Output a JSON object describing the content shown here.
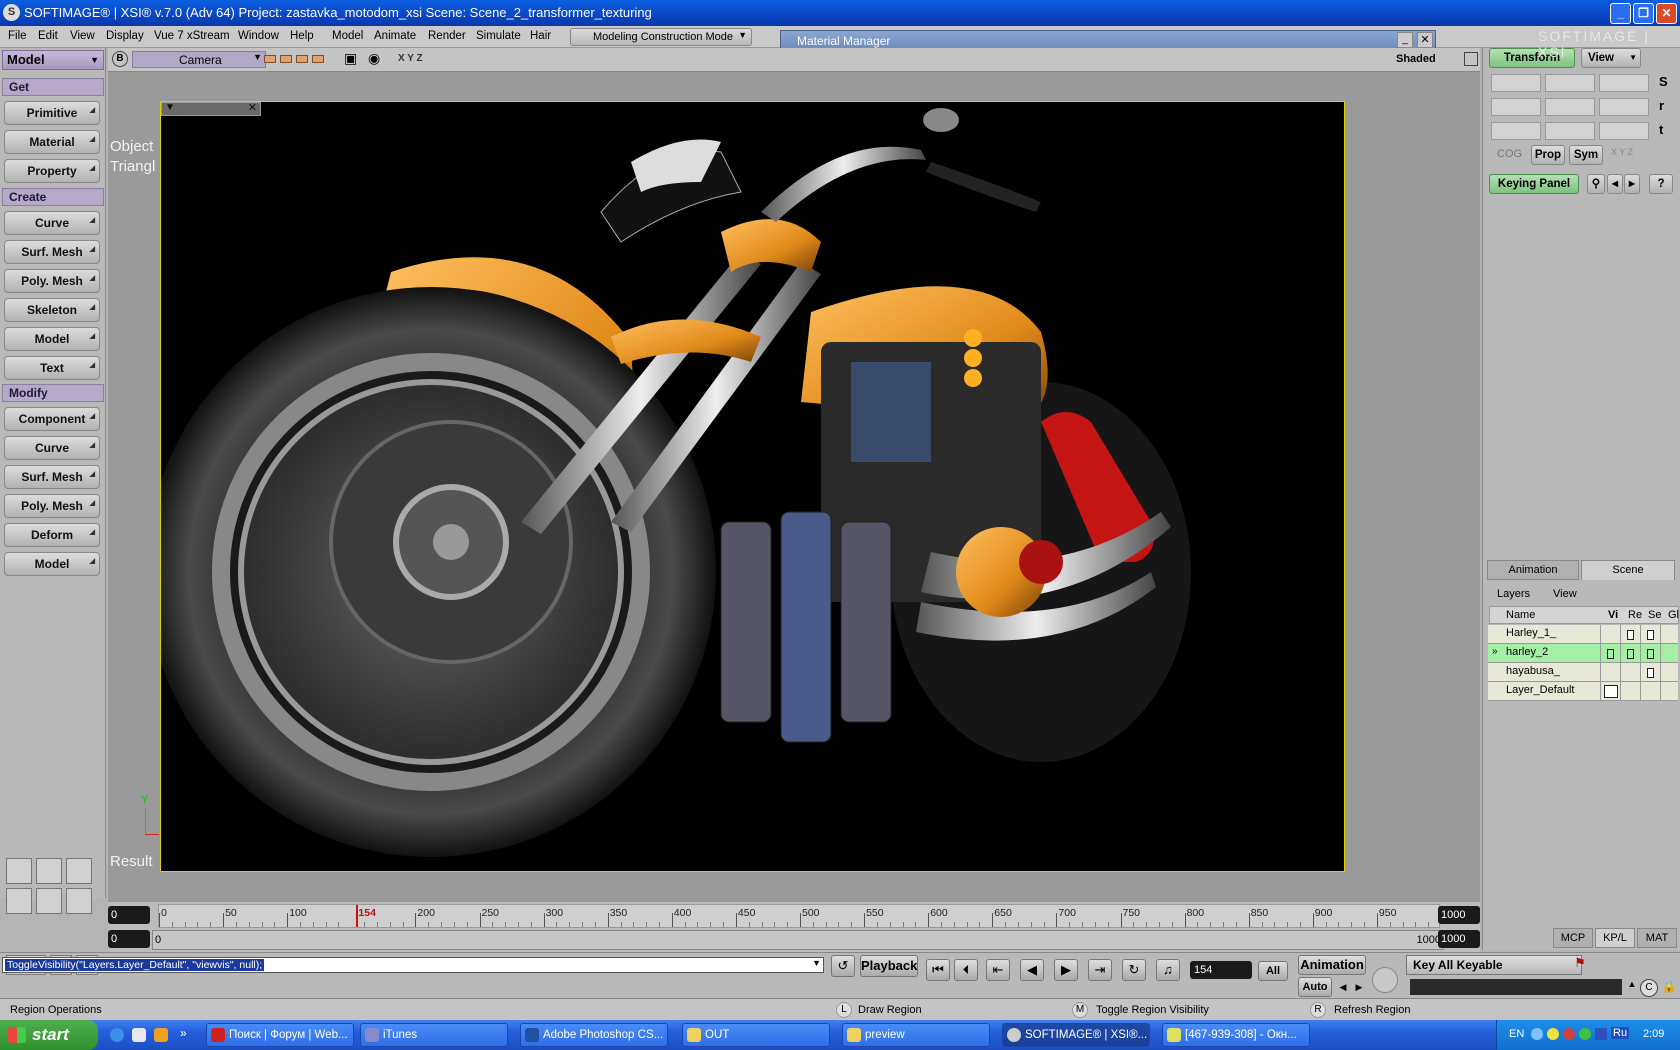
{
  "window": {
    "title": "SOFTIMAGE® | XSI® v.7.0 (Adv 64) Project: zastavka_motodom_xsi    Scene: Scene_2_transformer_texturing",
    "logo": "SOFTIMAGE | XSI"
  },
  "menubar": {
    "items": [
      "File",
      "Edit",
      "View",
      "Display",
      "Vue 7 xStream",
      "Window",
      "Help",
      "Model",
      "Animate",
      "Render",
      "Simulate",
      "Hair"
    ],
    "mode": "Modeling Construction Mode"
  },
  "material_manager": {
    "title": "Material Manager"
  },
  "left_panel": {
    "module": "Model",
    "sections": [
      {
        "title": "Get",
        "buttons": [
          "Primitive",
          "Material",
          "Property"
        ]
      },
      {
        "title": "Create",
        "buttons": [
          "Curve",
          "Surf. Mesh",
          "Poly. Mesh",
          "Skeleton",
          "Model",
          "Text"
        ]
      },
      {
        "title": "Modify",
        "buttons": [
          "Component",
          "Curve",
          "Surf. Mesh",
          "Poly. Mesh",
          "Deform",
          "Model"
        ]
      }
    ]
  },
  "viewport": {
    "letter": "B",
    "camera": "Camera",
    "axes": "X Y Z",
    "shading": "Shaded",
    "overlay_line1": "Object",
    "overlay_line2": "Triangl",
    "result_label": "Result",
    "y_axis": "Y"
  },
  "right_panel": {
    "transform": "Transform",
    "view": "View",
    "s": "S",
    "r": "r",
    "t": "t",
    "cog": "COG",
    "prop": "Prop",
    "sym": "Sym",
    "xyz": "X Y Z",
    "keying_panel": "Keying Panel",
    "help": "?",
    "tabs": [
      "Animation",
      "Scene"
    ],
    "layers_menu": "Layers",
    "view_menu": "View",
    "columns": [
      "Name",
      "Vi",
      "Re",
      "Se",
      "Gl"
    ],
    "layers": [
      {
        "name": "Harley_1_",
        "vi": false,
        "re": true,
        "se": true
      },
      {
        "name": "harley_2",
        "vi": true,
        "re": true,
        "se": true,
        "selected": true,
        "marker": "»"
      },
      {
        "name": "hayabusa_",
        "vi": false,
        "re": false,
        "se": true
      },
      {
        "name": "Layer_Default",
        "vi": true,
        "re": false,
        "se": false
      }
    ],
    "bottom_tabs": [
      "MCP",
      "KP/L",
      "MAT"
    ]
  },
  "timeline": {
    "start": "0",
    "labels": [
      "0",
      "50",
      "100",
      "154",
      "200",
      "250",
      "300",
      "350",
      "400",
      "450",
      "500",
      "550",
      "600",
      "650",
      "700",
      "750",
      "800",
      "850",
      "900",
      "950"
    ],
    "current": "154",
    "end": "1000",
    "range_start": "0",
    "range_inner": "0",
    "range_end_a": "1000",
    "range_end_b": "1000"
  },
  "cmd": {
    "command": "ToggleVisibility(\"Layers.Layer_Default\", \"viewvis\", null);",
    "playback": "Playback",
    "frame": "154",
    "all": "All",
    "animation": "Animation",
    "auto": "Auto",
    "key_all": "Key All Keyable"
  },
  "status": {
    "left": "Region Operations",
    "l_key": "L",
    "l_text": "Draw Region",
    "m_key": "M",
    "m_text": "Toggle Region Visibility",
    "r_key": "R",
    "r_text": "Refresh Region"
  },
  "taskbar": {
    "start": "start",
    "tasks": [
      "Поиск | Форум | Web...",
      "iTunes",
      "Adobe Photoshop CS...",
      "OUT",
      "preview",
      "SOFTIMAGE® | XSI®...",
      "[467-939-308] - Окн..."
    ],
    "lang": "EN",
    "kb": "Ru",
    "clock": "2:09"
  },
  "colors": {
    "accent_green": "#9ae69a",
    "header_purple": "#b7a8c8",
    "titlebar": "#0a46c4"
  }
}
